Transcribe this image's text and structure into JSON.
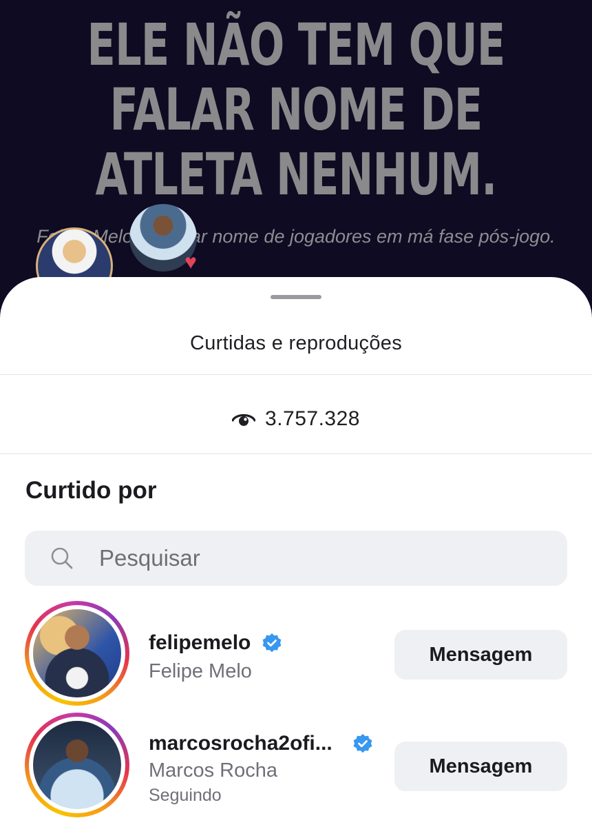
{
  "post": {
    "headline_lines": [
      "ELE NÃO TEM QUE",
      "FALAR NOME DE",
      "ATLETA NENHUM."
    ],
    "subline": "Felipe Melo s        el citar nome de jogadores em má fase pós-jogo."
  },
  "sheet": {
    "title": "Curtidas e reproduções",
    "views_icon": "eye-icon",
    "views_count": "3.757.328",
    "section_title": "Curtido por",
    "search": {
      "placeholder": "Pesquisar",
      "icon": "search-icon"
    }
  },
  "likers": [
    {
      "username": "felipemelo",
      "full_name": "Felipe Melo",
      "verified": true,
      "status": "",
      "button_label": "Mensagem"
    },
    {
      "username": "marcosrocha2ofi...",
      "full_name": "Marcos Rocha",
      "verified": true,
      "status": "Seguindo",
      "button_label": "Mensagem"
    }
  ],
  "colors": {
    "post_background": "#0e0b22",
    "verified_badge": "#3897f0",
    "button_background": "#eff0f3",
    "heart": "#e0445a"
  }
}
